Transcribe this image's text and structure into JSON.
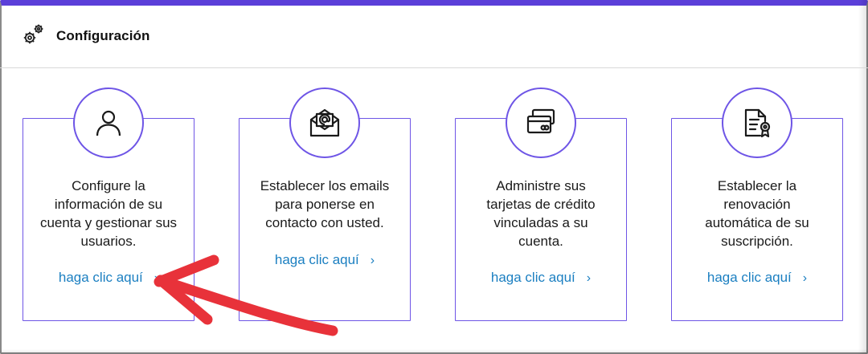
{
  "header": {
    "title": "Configuración",
    "icon": "gears-icon"
  },
  "colors": {
    "accent": "#5b3fd9",
    "card_border": "#6e55e6",
    "link": "#1b7fc1",
    "annotation_arrow": "#e8323a"
  },
  "cards": [
    {
      "icon": "user-icon",
      "lines": [
        "Configure la",
        "información de su",
        "cuenta y gestionar sus",
        "usuarios."
      ],
      "link": "haga clic aquí"
    },
    {
      "icon": "email-icon",
      "lines": [
        "Establecer los emails",
        "para ponerse en",
        "contacto con usted."
      ],
      "link": "haga clic aquí"
    },
    {
      "icon": "credit-card-icon",
      "lines": [
        "Administre sus",
        "tarjetas de crédito",
        "vinculadas a su",
        "cuenta."
      ],
      "link": "haga clic aquí"
    },
    {
      "icon": "certificate-icon",
      "lines": [
        "Establecer la",
        "renovación",
        "automática de su",
        "suscripción."
      ],
      "link": "haga clic aquí"
    }
  ],
  "chevron": "›"
}
